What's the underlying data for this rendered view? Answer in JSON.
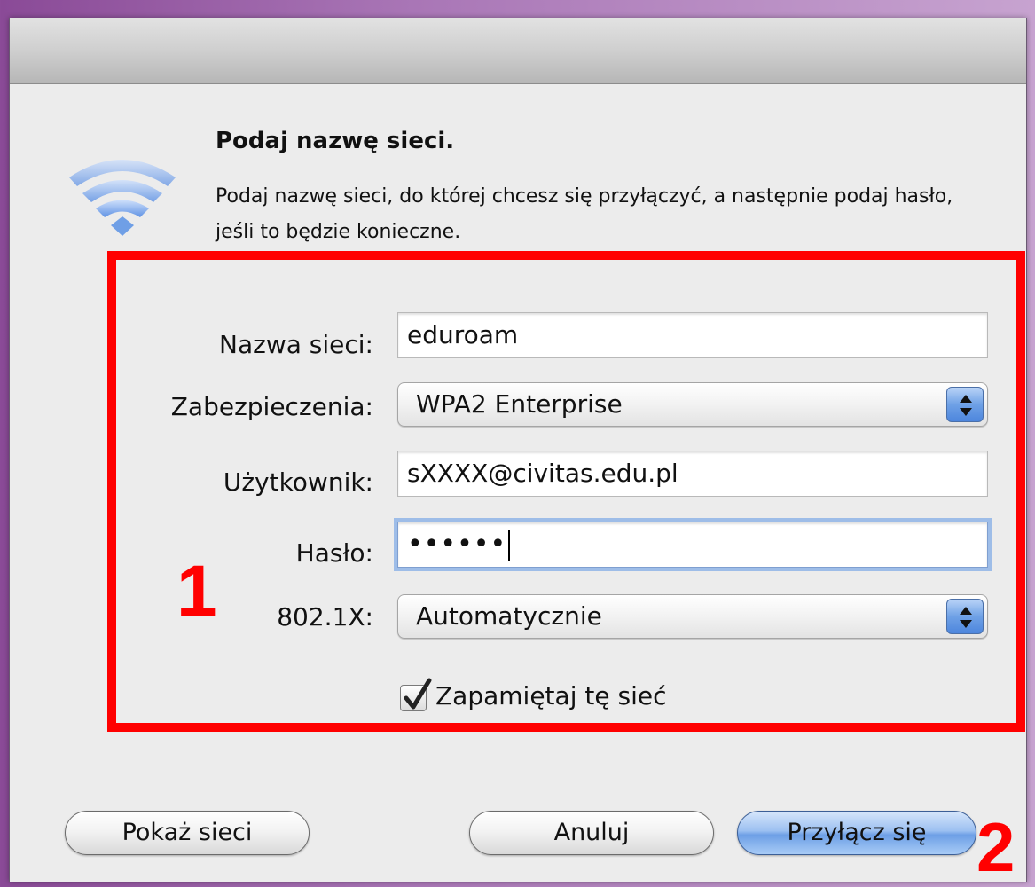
{
  "dialog": {
    "heading": "Podaj nazwę sieci.",
    "description": "Podaj nazwę sieci, do której chcesz się przyłączyć, a następnie podaj hasło, jeśli to będzie konieczne."
  },
  "form": {
    "network_name_label": "Nazwa sieci:",
    "network_name_value": "eduroam",
    "security_label": "Zabezpieczenia:",
    "security_value": "WPA2 Enterprise",
    "user_label": "Użytkownik:",
    "user_value": "sXXXX@civitas.edu.pl",
    "password_label": "Hasło:",
    "password_masked": "••••••",
    "auth_label": "802.1X:",
    "auth_value": "Automatycznie",
    "remember_label": "Zapamiętaj tę sieć",
    "remember_checked": true
  },
  "buttons": {
    "show_networks": "Pokaż sieci",
    "cancel": "Anuluj",
    "join": "Przyłącz się"
  },
  "annotations": {
    "step1": "1",
    "step2": "2"
  },
  "colors": {
    "highlight": "#ff0000",
    "focus_ring": "#9ebde8",
    "wifi_icon": "#6f9fe6"
  },
  "icons": {
    "wifi": "wifi-icon",
    "select_arrows": "up-down-arrows-icon",
    "checkmark": "checkmark-icon"
  }
}
